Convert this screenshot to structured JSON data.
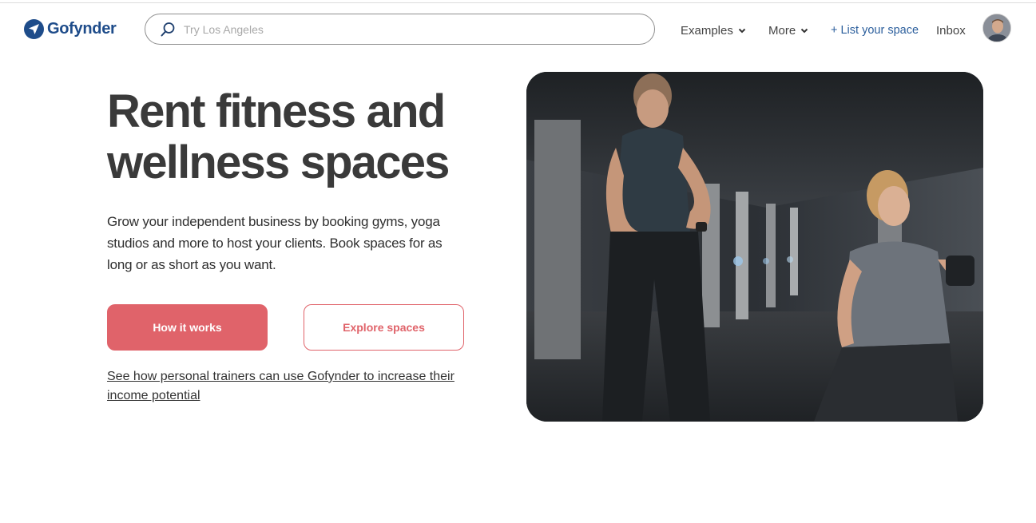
{
  "brand": {
    "name": "Gofynder",
    "color": "#1e4c8a"
  },
  "search": {
    "placeholder": "Try Los Angeles",
    "value": ""
  },
  "nav": {
    "examples": "Examples",
    "more": "More",
    "list_space": "+ List your space",
    "inbox": "Inbox"
  },
  "hero": {
    "title": "Rent fitness and wellness spaces",
    "description": "Grow your independent business by booking gyms, yoga studios and more to host your clients. Book spaces for as long or as short as you want.",
    "primary_button": "How it works",
    "secondary_button": "Explore spaces",
    "trainer_link": "See how personal trainers can use Gofynder to increase their income potential"
  },
  "colors": {
    "accent": "#e0636a",
    "link": "#2b5e9c",
    "text": "#3a3a3a"
  },
  "icons": {
    "logo": "paper-plane-icon",
    "search": "search-icon",
    "dropdown": "chevron-down-icon"
  }
}
